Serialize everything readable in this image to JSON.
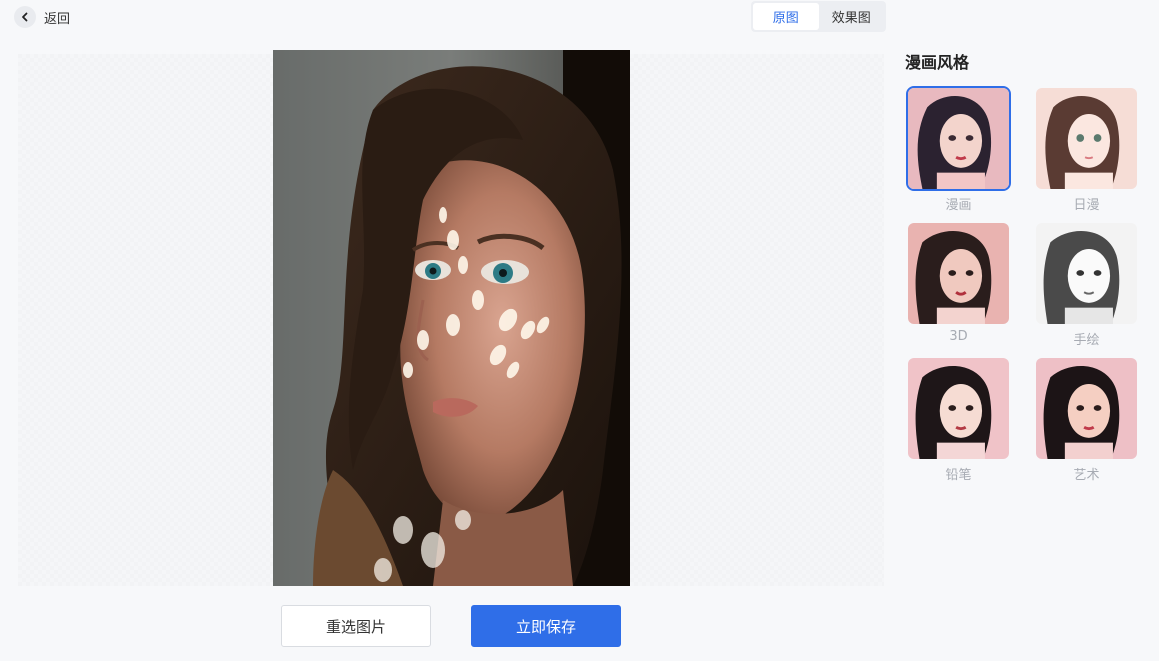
{
  "header": {
    "back_label": "返回",
    "view_toggle": [
      "原图",
      "效果图"
    ],
    "active_view": "原图"
  },
  "panel": {
    "title": "漫画风格",
    "styles": [
      {
        "label": "漫画",
        "selected": true
      },
      {
        "label": "日漫",
        "selected": false
      },
      {
        "label": "3D",
        "selected": false
      },
      {
        "label": "手绘",
        "selected": false
      },
      {
        "label": "铅笔",
        "selected": false
      },
      {
        "label": "艺术",
        "selected": false
      }
    ]
  },
  "actions": {
    "reselect_label": "重选图片",
    "save_label": "立即保存"
  },
  "colors": {
    "accent": "#2f6ee8",
    "background": "#f7f8fa"
  }
}
